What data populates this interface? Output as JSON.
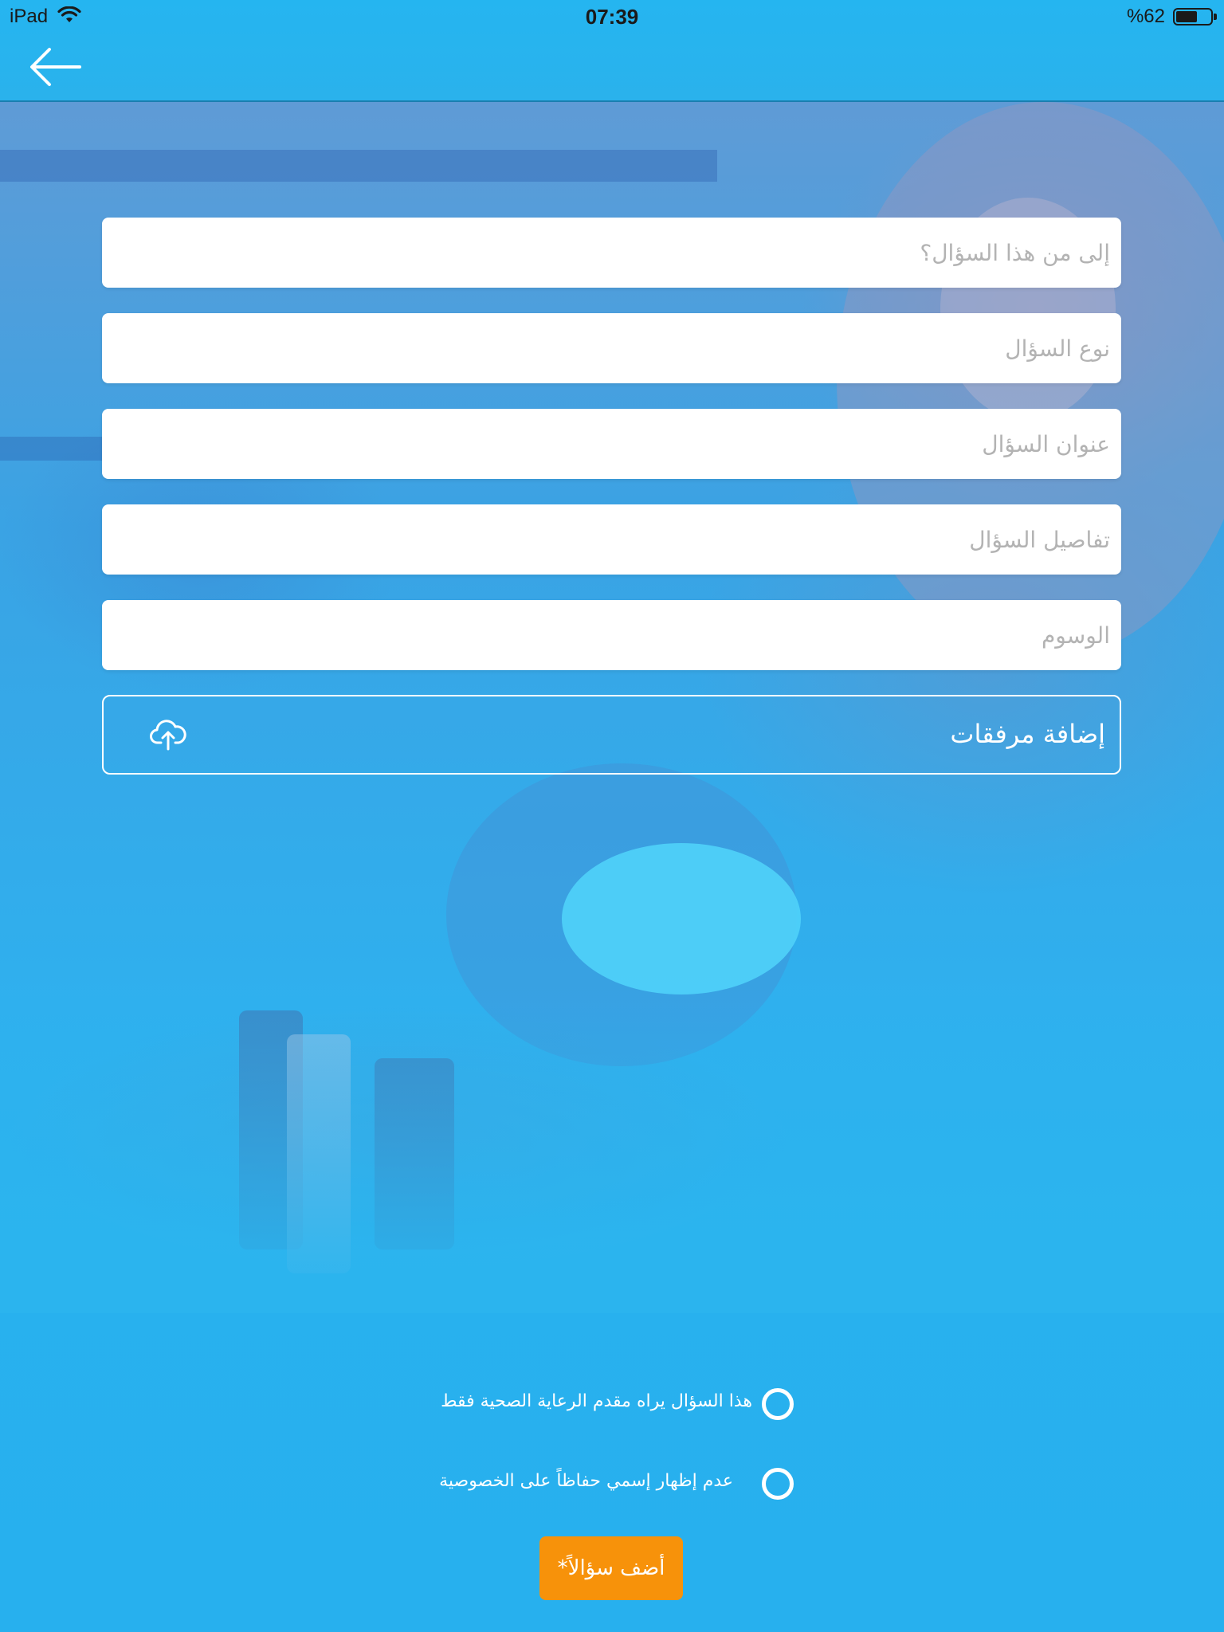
{
  "status_bar": {
    "device": "iPad",
    "time": "07:39",
    "battery_percent": "%62",
    "battery_level": 0.62
  },
  "nav": {
    "back_icon": "arrow-left-icon"
  },
  "form": {
    "recipient_placeholder": "إلى من هذا السؤال؟",
    "type_placeholder": "نوع السؤال",
    "title_placeholder": "عنوان السؤال",
    "details_placeholder": "تفاصيل السؤال",
    "tags_placeholder": "الوسوم",
    "attachments_label": "إضافة مرفقات",
    "attachments_icon": "cloud-upload-icon"
  },
  "options": [
    {
      "label": "هذا السؤال يراه مقدم الرعاية الصحية فقط",
      "selected": false
    },
    {
      "label": "عدم إظهار إسمي حفاظاً على الخصوصية",
      "selected": false
    }
  ],
  "submit_label": "أضف سؤالاً*",
  "colors": {
    "primary": "#2bb4ee",
    "accent": "#f7920a",
    "field_background": "#ffffff",
    "placeholder": "#b3b3b3"
  }
}
